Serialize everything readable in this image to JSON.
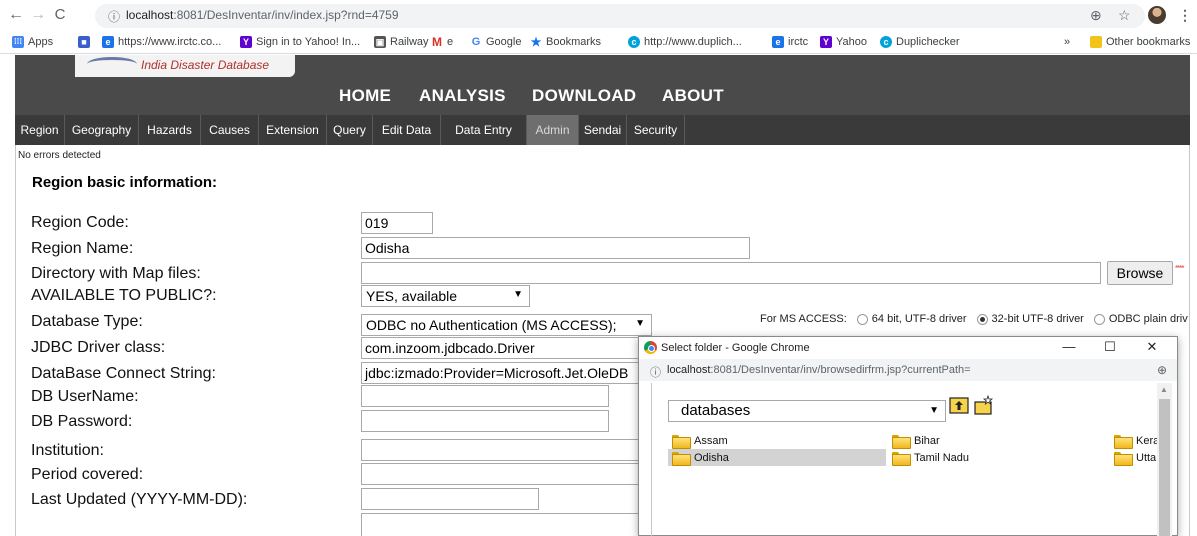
{
  "browser": {
    "url_host": "localhost",
    "url_rest": ":8081/DesInventar/inv/index.jsp?rnd=4759",
    "bookmarks": [
      {
        "label": "Apps",
        "icon": "apps-grid-icon",
        "color": "#4285f4"
      },
      {
        "label": "",
        "icon": "ms-icon",
        "color": "#3a5fcd"
      },
      {
        "label": "https://www.irctc.co...",
        "icon": "irctc-icon",
        "color": "#1a73e8"
      },
      {
        "label": "Sign in to Yahoo! In...",
        "icon": "yahoo-icon",
        "color": "#5f01d1"
      },
      {
        "label": "Railway",
        "icon": "railway-icon",
        "color": "#555555"
      },
      {
        "label": "e",
        "icon": "gmail-icon",
        "color": "#d93025"
      },
      {
        "label": "Google",
        "icon": "google-icon",
        "color": "#4285f4"
      },
      {
        "label": "Bookmarks",
        "icon": "star-icon",
        "color": "#1a73e8"
      },
      {
        "label": "http://www.duplich...",
        "icon": "duplichecker-icon",
        "color": "#00a3d9"
      },
      {
        "label": "irctc",
        "icon": "irctc-icon",
        "color": "#1a73e8"
      },
      {
        "label": "Yahoo",
        "icon": "yahoo-icon",
        "color": "#5f01d1"
      },
      {
        "label": "Duplichecker",
        "icon": "duplichecker-icon",
        "color": "#00a3d9"
      }
    ],
    "more_bookmarks": "»",
    "other_bookmarks": "Other bookmarks"
  },
  "app": {
    "logo_text": "India Disaster Database",
    "main_nav": [
      "HOME",
      "ANALYSIS",
      "DOWNLOAD",
      "ABOUT"
    ],
    "sub_nav": [
      "Region",
      "Geography",
      "Hazards",
      "Causes",
      "Extension",
      "Query",
      "Edit Data",
      "Data Entry",
      "Admin",
      "Sendai",
      "Security"
    ],
    "active_sub_nav": "Admin"
  },
  "form": {
    "status": "No errors detected",
    "title": "Region basic information:",
    "labels": {
      "region_code": "Region Code:",
      "region_name": "Region Name:",
      "map_dir": "Directory with Map files:",
      "public": "AVAILABLE TO PUBLIC?:",
      "db_type": "Database Type:",
      "jdbc": "JDBC Driver class:",
      "conn": "DataBase Connect String:",
      "user": "DB UserName:",
      "pass": "DB Password:",
      "institution": "Institution:",
      "period": "Period covered:",
      "updated": "Last Updated (YYYY-MM-DD):"
    },
    "values": {
      "region_code": "019",
      "region_name": "Odisha",
      "map_dir": "",
      "public": "YES, available",
      "db_type": "ODBC no Authentication (MS ACCESS);",
      "jdbc": "com.inzoom.jdbcado.Driver",
      "conn": "jdbc:izmado:Provider=Microsoft.Jet.OleDB",
      "user": "",
      "pass": "",
      "institution": "",
      "period": "",
      "updated": ""
    },
    "browse_label": "Browse",
    "asterisk": "****",
    "ms_access_label": "For MS ACCESS:",
    "radio_options": [
      {
        "label": "64 bit, UTF-8 driver",
        "checked": false
      },
      {
        "label": "32-bit UTF-8 driver",
        "checked": true
      },
      {
        "label": "ODBC plain driv",
        "checked": false
      }
    ]
  },
  "popup": {
    "title": "Select folder - Google Chrome",
    "url_host": "localhost",
    "url_rest": ":8081/DesInventar/inv/browsedirfrm.jsp?currentPath=",
    "folder_select": "databases",
    "folders": [
      "Assam",
      "Bihar",
      "Kera",
      "Odisha",
      "Tamil Nadu",
      "Utta"
    ],
    "selected_folder": "Odisha"
  }
}
